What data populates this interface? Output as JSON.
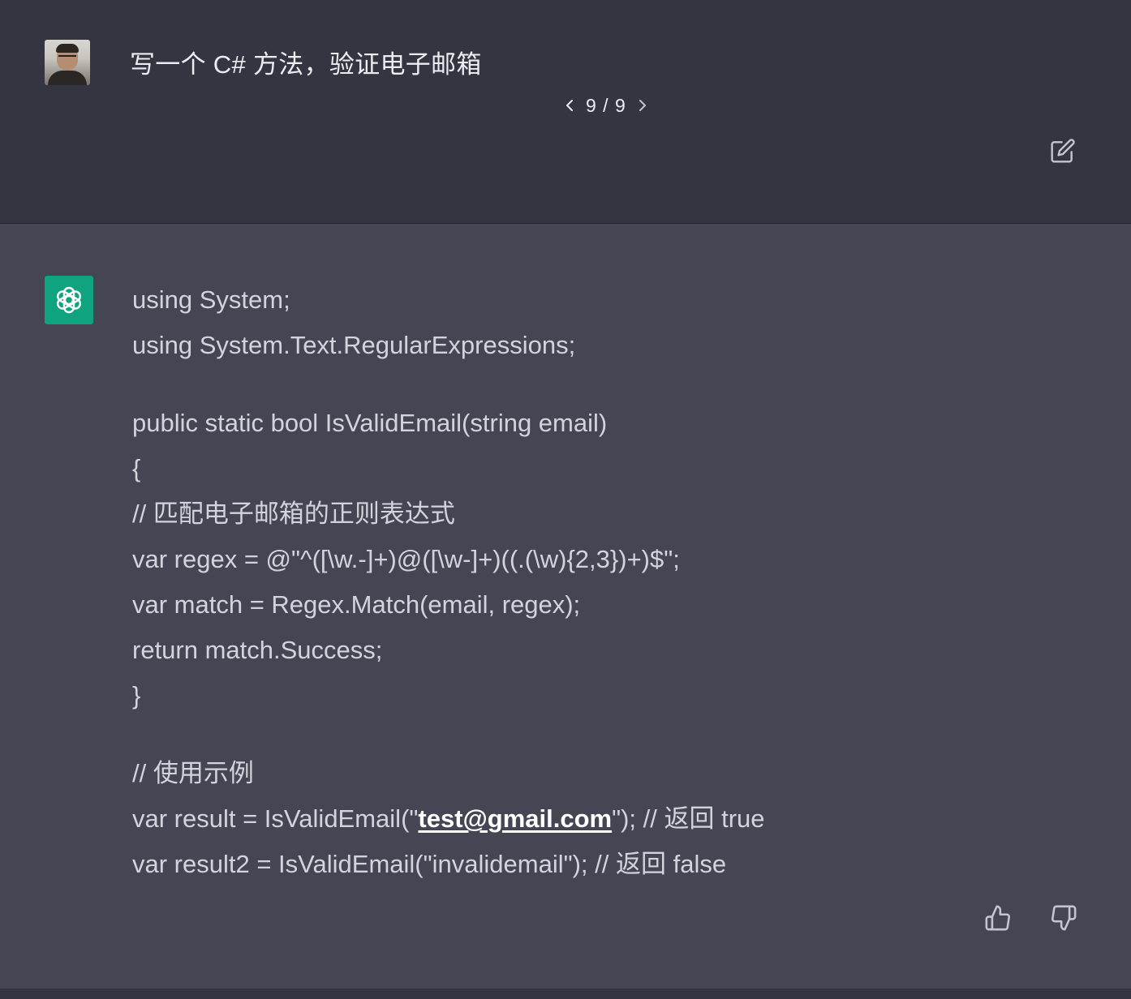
{
  "user": {
    "avatar_icon": "user-photo-avatar",
    "message": "写一个 C# 方法，验证电子邮箱"
  },
  "pager": {
    "count": "9 / 9",
    "prev_icon": "chevron-left-icon",
    "next_icon": "chevron-right-icon"
  },
  "edit_icon": "edit-square-icon",
  "assistant": {
    "avatar_icon": "openai-logo-icon",
    "avatar_color": "#10a37f",
    "lines": {
      "l1": "using System;",
      "l2": "using System.Text.RegularExpressions;",
      "l3": "public static bool IsValidEmail(string email)",
      "l4": "{",
      "l5": "// 匹配电子邮箱的正则表达式",
      "l6": "var regex = @\"^([\\w.-]+)@([\\w-]+)((.(\\w){2,3})+)$\";",
      "l7": "var match = Regex.Match(email, regex);",
      "l8": "return match.Success;",
      "l9": "}",
      "l10": "// 使用示例",
      "l11_prefix": "var result = IsValidEmail(\"",
      "l11_link": "test@gmail.com",
      "l11_suffix": "\"); // 返回 true",
      "l12": "var result2 = IsValidEmail(\"invalidemail\"); // 返回 false"
    }
  },
  "feedback": {
    "thumbs_up_icon": "thumbs-up-icon",
    "thumbs_down_icon": "thumbs-down-icon"
  },
  "colors": {
    "user_bg": "#343541",
    "assistant_bg": "#444654",
    "text": "#d1d5db"
  }
}
